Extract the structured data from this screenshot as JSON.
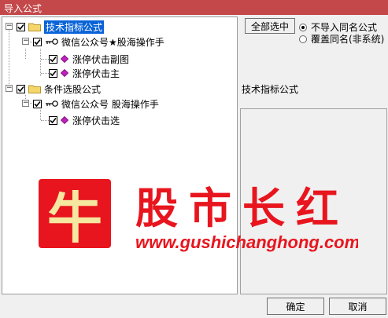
{
  "window": {
    "title": "导入公式"
  },
  "tree": {
    "items": [
      {
        "label": "技术指标公式",
        "type": "folder",
        "level": 0,
        "checked": true,
        "selected": true
      },
      {
        "label": "微信公众号★股海操作手",
        "type": "author",
        "level": 1,
        "checked": true
      },
      {
        "label": "涨停伏击副图",
        "type": "formula",
        "level": 2,
        "checked": true
      },
      {
        "label": "涨停伏击主",
        "type": "formula",
        "level": 2,
        "checked": true
      },
      {
        "label": "条件选股公式",
        "type": "folder",
        "level": 0,
        "checked": true
      },
      {
        "label": "微信公众号 股海操作手",
        "type": "author",
        "level": 1,
        "checked": true
      },
      {
        "label": "涨停伏击选",
        "type": "formula",
        "level": 2,
        "checked": true
      }
    ]
  },
  "options": {
    "select_all_label": "全部选中",
    "no_import_same_label": "不导入同名公式",
    "overwrite_label": "覆盖同名(非系统)",
    "selected_option": "不导入同名公式"
  },
  "description": {
    "title": "技术指标公式"
  },
  "watermark": {
    "logo_char": "牛",
    "brand": "股市长红",
    "url": "www.gushichanghong.com",
    "color": "#e8151e",
    "logo_text_color": "#f5e7a0"
  },
  "buttons": {
    "ok_label": "确定",
    "cancel_label": "取消"
  },
  "colors": {
    "title_bar": "#c4484a",
    "selection": "#0a64d8",
    "folder": "#f5d66b",
    "diamond": "#c21fc2"
  }
}
